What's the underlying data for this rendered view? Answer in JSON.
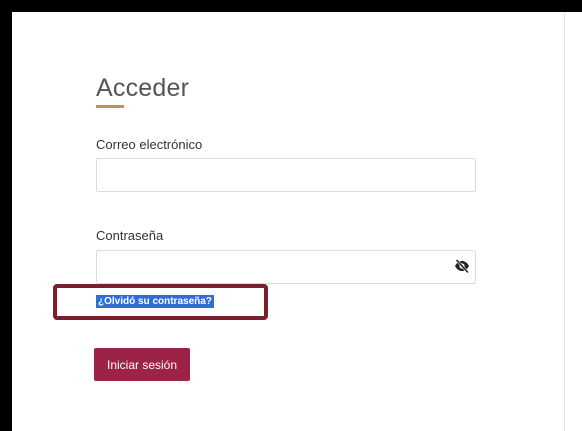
{
  "form": {
    "title": "Acceder",
    "email": {
      "label": "Correo electrónico",
      "value": "",
      "placeholder": ""
    },
    "password": {
      "label": "Contraseña",
      "value": "",
      "placeholder": "",
      "toggle_icon": "eye-slash-icon"
    },
    "forgot_link": "¿Olvidó su contraseña?",
    "submit_label": "Iniciar sesión"
  },
  "colors": {
    "accent_underline": "#b5955a",
    "button": "#9d2346",
    "link_selection": "#2f6fd1",
    "highlight_box": "#7a1f2b"
  }
}
